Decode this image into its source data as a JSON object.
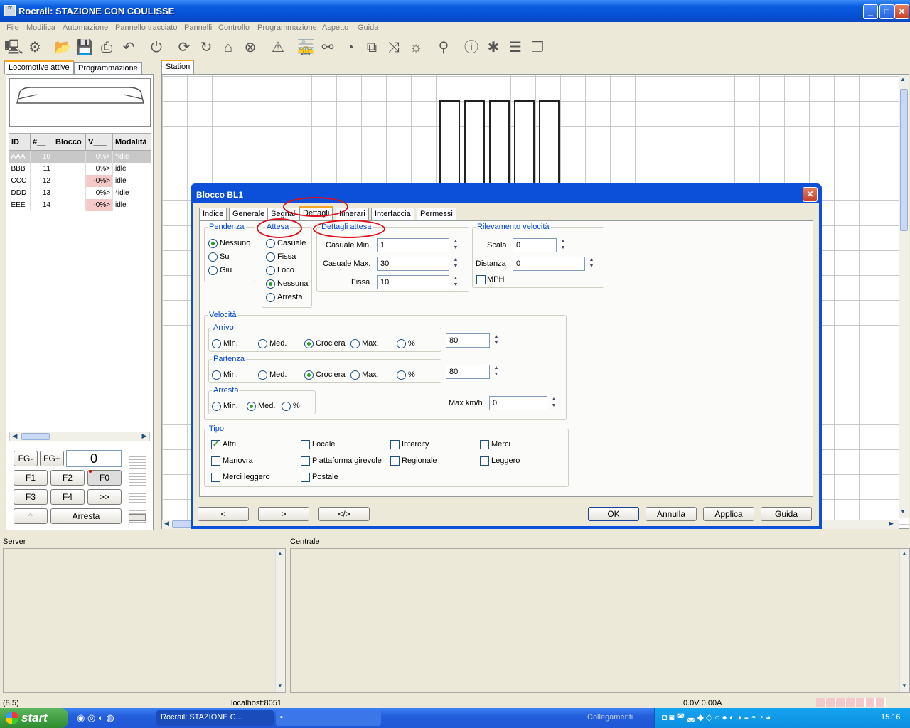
{
  "window": {
    "title": "Rocrail: STAZIONE CON COULISSE",
    "minimize": "_",
    "maximize": "□",
    "close": "✕"
  },
  "menu": [
    "File",
    "Modifica",
    "Automazione",
    "Pannello tracciato",
    "Pannelli",
    "Controllo",
    "Programmazione",
    "Aspetto",
    "Guida"
  ],
  "left_tabs": {
    "active": "Locomotive attive",
    "other": "Programmazione"
  },
  "loco_table": {
    "headers": [
      "ID",
      "#__",
      "Blocco",
      "V___",
      "Modalità"
    ],
    "rows": [
      {
        "id": "AAA",
        "num": "10",
        "block": "",
        "v": "0%>",
        "mode": "*idle"
      },
      {
        "id": "BBB",
        "num": "11",
        "block": "",
        "v": "0%>",
        "mode": "idle"
      },
      {
        "id": "CCC",
        "num": "12",
        "block": "",
        "v": "-0%>",
        "mode": "idle"
      },
      {
        "id": "DDD",
        "num": "13",
        "block": "",
        "v": "0%>",
        "mode": "*idle"
      },
      {
        "id": "EEE",
        "num": "14",
        "block": "",
        "v": "-0%>",
        "mode": "idle"
      }
    ]
  },
  "throttle": {
    "fg_minus": "FG-",
    "fg_plus": "FG+",
    "speed": "0",
    "f1": "F1",
    "f2": "F2",
    "f0": "F0",
    "f3": "F3",
    "f4": "F4",
    "more": ">>",
    "up": "^",
    "stop": "Arresta"
  },
  "station_tab": "Station",
  "dialog": {
    "title": "Blocco BL1",
    "tabs": [
      "Indice",
      "Generale",
      "Segnali",
      "Dettagli",
      "Itinerari",
      "Interfaccia",
      "Permessi"
    ],
    "active_tab": "Dettagli",
    "pendenza": {
      "legend": "Pendenza",
      "options": [
        "Nessuno",
        "Su",
        "Giù"
      ]
    },
    "attesa": {
      "legend": "Attesa",
      "options": [
        "Casuale",
        "Fissa",
        "Loco",
        "Nessuna",
        "Arresta"
      ]
    },
    "dettagli_attesa": {
      "legend": "Dettagli attesa",
      "casuale_min_label": "Casuale Min.",
      "casuale_min": "1",
      "casuale_max_label": "Casuale Max.",
      "casuale_max": "30",
      "fissa_label": "Fissa",
      "fissa": "10"
    },
    "rilevamento": {
      "legend": "Rilevamento velocità",
      "scala_label": "Scala",
      "scala": "0",
      "distanza_label": "Distanza",
      "distanza": "0",
      "mph": "MPH"
    },
    "velocita": {
      "legend": "Velocità",
      "arrivo": {
        "legend": "Arrivo",
        "value": "80"
      },
      "partenza": {
        "legend": "Partenza",
        "value": "80"
      },
      "arresta": {
        "legend": "Arresta"
      },
      "opt_min": "Min.",
      "opt_med": "Med.",
      "opt_crociera": "Crociera",
      "opt_max": "Max.",
      "opt_pct": "%",
      "maxkmh_label": "Max km/h",
      "maxkmh": "0"
    },
    "tipo": {
      "legend": "Tipo",
      "items": [
        "Altri",
        "Locale",
        "Intercity",
        "Merci",
        "Manovra",
        "Piattaforma girevole",
        "Regionale",
        "Leggero",
        "Merci leggero",
        "Postale"
      ]
    },
    "buttons": {
      "prev": "<",
      "next": ">",
      "xml": "</>",
      "ok": "OK",
      "cancel": "Annulla",
      "apply": "Applica",
      "help": "Guida"
    }
  },
  "panes": {
    "server": "Server",
    "centrale": "Centrale"
  },
  "status": {
    "coords": "(8,5)",
    "host": "localhost:8051",
    "power": "0.0V 0.00A"
  },
  "taskbar": {
    "start": "start",
    "task1": "Rocrail: STAZIONE C...",
    "collegamenti": "Collegamenti",
    "time": "15.16"
  },
  "colors": {
    "titlebar": "#0a5ddf",
    "dialog_frame": "#0c4fd8",
    "annotation": "#e0101a",
    "legend": "#0046d5"
  }
}
